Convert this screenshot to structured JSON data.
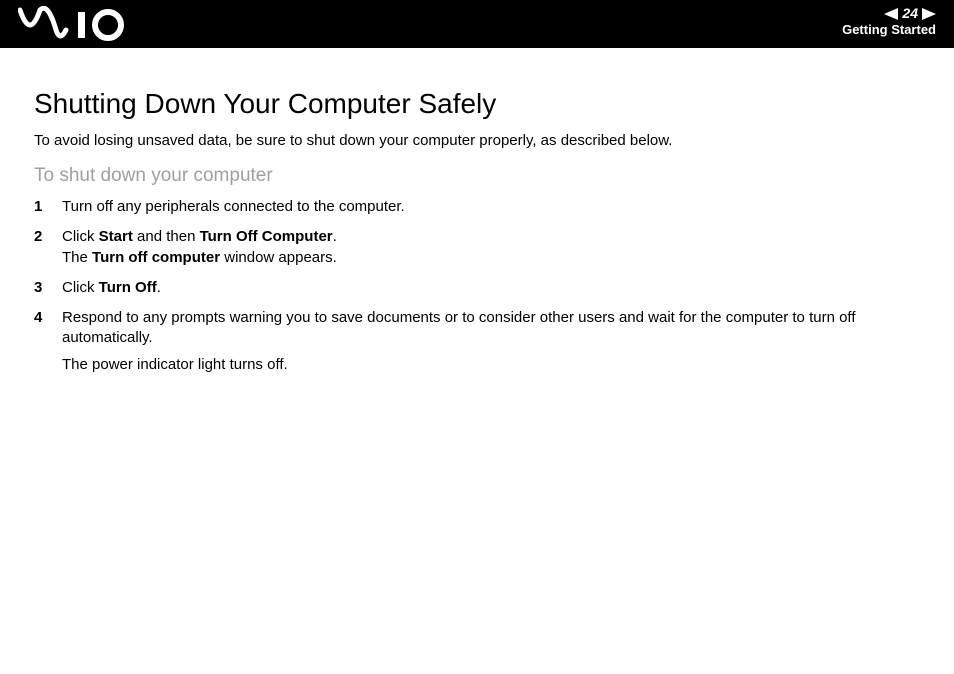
{
  "header": {
    "page_number": "24",
    "section": "Getting Started"
  },
  "page": {
    "title": "Shutting Down Your Computer Safely",
    "intro": "To avoid losing unsaved data, be sure to shut down your computer properly, as described below.",
    "subhead": "To shut down your computer",
    "steps": {
      "s1": "Turn off any peripherals connected to the computer.",
      "s2_a": "Click ",
      "s2_b": "Start",
      "s2_c": " and then ",
      "s2_d": "Turn Off Computer",
      "s2_e": ".",
      "s2_f": "The ",
      "s2_g": "Turn off computer",
      "s2_h": " window appears.",
      "s3_a": "Click ",
      "s3_b": "Turn Off",
      "s3_c": ".",
      "s4_a": "Respond to any prompts warning you to save documents or to consider other users and wait for the computer to turn off automatically.",
      "s4_b": "The power indicator light turns off."
    }
  }
}
